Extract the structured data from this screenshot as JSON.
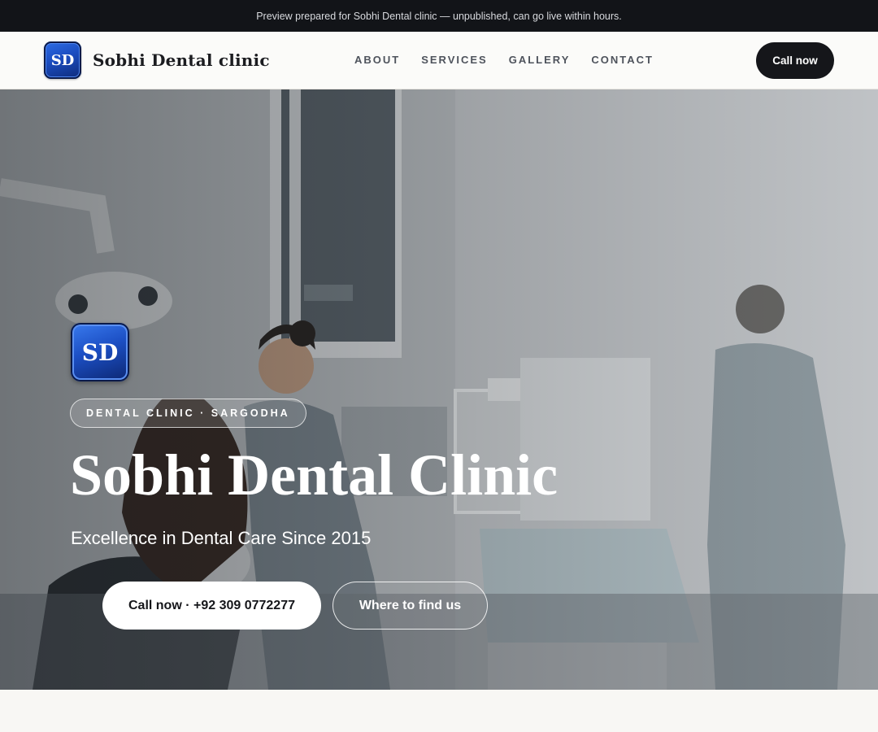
{
  "preview_banner": {
    "text": "Preview prepared for Sobhi Dental clinic — unpublished, can go live within hours."
  },
  "header": {
    "logo_text": "SD",
    "brand_name": "Sobhi Dental clinic",
    "nav": [
      {
        "label": "ABOUT"
      },
      {
        "label": "SERVICES"
      },
      {
        "label": "GALLERY"
      },
      {
        "label": "CONTACT"
      }
    ],
    "call_button": "Call now"
  },
  "hero": {
    "logo_text": "SD",
    "tag": "DENTAL CLINIC · SARGODHA",
    "title": "Sobhi Dental Clinic",
    "subtitle": "Excellence in Dental Care Since 2015",
    "primary_button": "Call now · +92 309 0772277",
    "secondary_button": "Where to find us"
  },
  "colors": {
    "banner_bg": "#121418",
    "header_bg": "#fbfbf9",
    "accent_dark": "#15161a",
    "logo_blue": "#1a4cbf"
  }
}
